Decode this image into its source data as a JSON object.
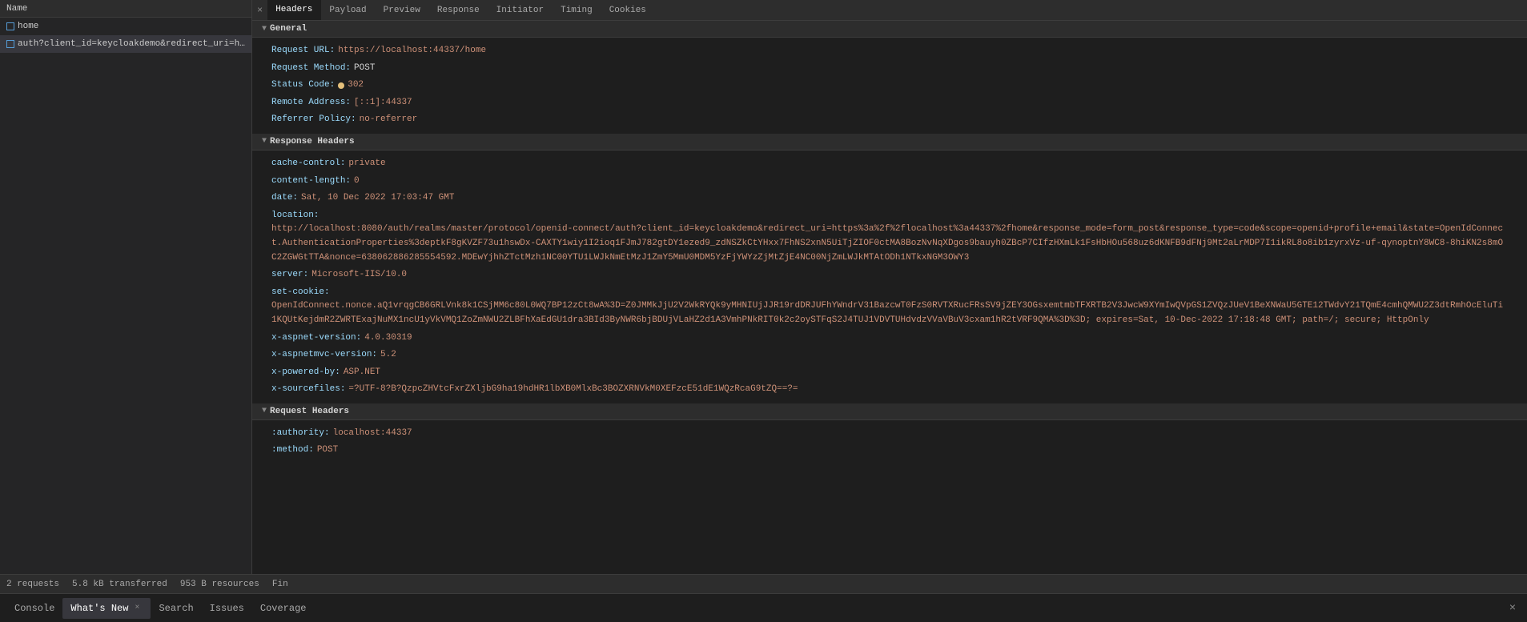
{
  "leftPanel": {
    "header": "Name",
    "items": [
      {
        "name": "home",
        "selected": false
      },
      {
        "name": "auth?client_id=keycloakdemo&redirect_uri=https%...",
        "selected": true
      }
    ]
  },
  "tabs": {
    "closeSymbol": "×",
    "items": [
      {
        "label": "Headers",
        "active": true
      },
      {
        "label": "Payload",
        "active": false
      },
      {
        "label": "Preview",
        "active": false
      },
      {
        "label": "Response",
        "active": false
      },
      {
        "label": "Initiator",
        "active": false
      },
      {
        "label": "Timing",
        "active": false
      },
      {
        "label": "Cookies",
        "active": false
      }
    ]
  },
  "sections": {
    "general": {
      "title": "General",
      "arrow": "▼",
      "fields": [
        {
          "name": "Request URL:",
          "value": "https://localhost:44337/home"
        },
        {
          "name": "Request Method:",
          "value": "POST"
        },
        {
          "name": "Status Code:",
          "value": "302",
          "hasStatusDot": true
        },
        {
          "name": "Remote Address:",
          "value": "[::1]:44337"
        },
        {
          "name": "Referrer Policy:",
          "value": "no-referrer"
        }
      ]
    },
    "responseHeaders": {
      "title": "Response Headers",
      "arrow": "▼",
      "fields": [
        {
          "name": "cache-control:",
          "value": "private"
        },
        {
          "name": "content-length:",
          "value": "0"
        },
        {
          "name": "date:",
          "value": "Sat, 10 Dec 2022 17:03:47 GMT"
        },
        {
          "name": "location:",
          "value": "http://localhost:8080/auth/realms/master/protocol/openid-connect/auth?client_id=keycloakdemo&redirect_uri=https%3a%2f%2flocalhost%3a44337%2fhome&response_mode=form_post&response_type=code&scope=openid+profile+email&state=OpenIdConnect.AuthenticationProperties%3deptkF8gKVZF73u1hswDx-CAXTY1wiy1I2ioq1FJmJ782gtDY1ezed9_zdNSZkCtYHxx7FhNS2xnN5UiTjZIOF0ctMA8BozNvNqXDgos9bauyh0ZBcP7CIfzHXmLk1FsHbHOu568uz6dKNFB9dFNj9Mt2aLrMDP7I1ikRL8o8ib1zyrxVz-uf-qynoptnY8WC8-8hiKN2s8mOC2ZGWGtTTA&nonce=638062886285554592.MDEwYjhhZTctMzh1NC00YTU1LWJkNmEtMzJ1ZmY5MmU0MDM5YzFjYWYzZjMtZjE4NC00NjZmLWJkMTAtODh1NTkxNGM3OWY3"
        },
        {
          "name": "server:",
          "value": "Microsoft-IIS/10.0"
        },
        {
          "name": "set-cookie:",
          "value": "OpenIdConnect.nonce.aQ1vrqgCB6GRLVnk8k1CSjMM6c80L0WQ7BP12zCt8wA%3D=Z0JMMkJjU2V2WkRYQk9yMHNIUjJJR19rdDRJUFhYWndrV31BazcwT0FzS0RVTXRucFRsSV9jZEY3OGsxemtmbTFXRTB2V3JwcW9XYmIwQVpGS1ZVQzJUeV1BeXNWaU5GTE12TWdvY21TQmE4cmhQMWU2Z3dtRmhOcEluTi1KQUtKejdmR2ZWRTExajNuMX1ncU1yVkVMQ1ZoZmNWU2ZLBFhXaEdGU1dra3BId3ByNWR6bjBDUjVLaHZ2d1A3VmhPNkRIT0k2c2oySTFqS2J4TUJ1VDVTUHdvdzVVaVBuV3cxam1hR2tVRF9QMA%3D%3D; expires=Sat, 10-Dec-2022 17:18:48 GMT; path=/; secure; HttpOnly"
        },
        {
          "name": "x-aspnet-version:",
          "value": "4.0.30319"
        },
        {
          "name": "x-aspnetmvc-version:",
          "value": "5.2"
        },
        {
          "name": "x-powered-by:",
          "value": "ASP.NET"
        },
        {
          "name": "x-sourcefiles:",
          "value": "=?UTF-8?B?QzpcZHVtcFxrZXljbG9ha19hdHR1lbXB0MlxBc3BOZXRNVkM0XEFzcE51dE1WQzRcaG9tZQ==?="
        }
      ]
    },
    "requestHeaders": {
      "title": "Request Headers",
      "arrow": "▼",
      "fields": [
        {
          "name": ":authority:",
          "value": "localhost:44337"
        },
        {
          "name": ":method:",
          "value": "POST"
        }
      ]
    }
  },
  "statusBar": {
    "requests": "2 requests",
    "transferred": "5.8 kB transferred",
    "resources": "953 B resources",
    "finish": "Fin"
  },
  "bottomTabs": {
    "items": [
      {
        "label": "Console",
        "active": false,
        "hasClose": false
      },
      {
        "label": "What's New",
        "active": true,
        "hasClose": true
      },
      {
        "label": "Search",
        "active": false,
        "hasClose": false
      },
      {
        "label": "Issues",
        "active": false,
        "hasClose": false
      },
      {
        "label": "Coverage",
        "active": false,
        "hasClose": false
      }
    ],
    "closeSymbol": "×"
  }
}
